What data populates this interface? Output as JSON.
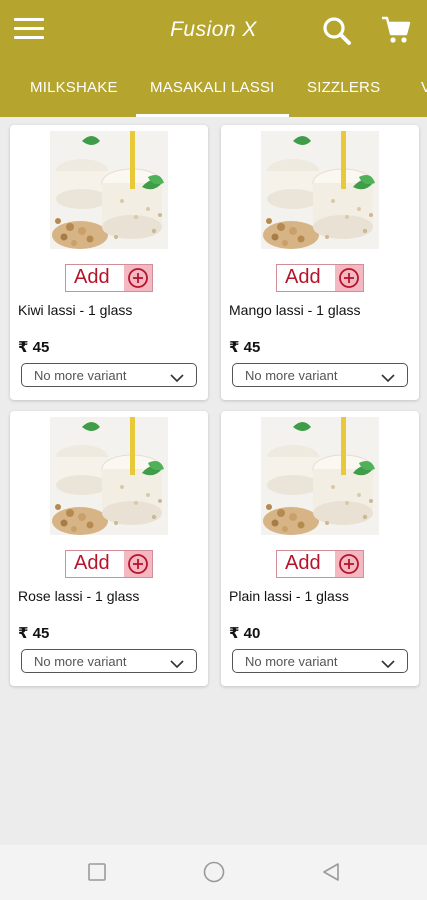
{
  "app": {
    "title": "Fusion X",
    "colors": {
      "primary": "#b5a52e",
      "accent": "#b5142a",
      "background": "#ececec"
    },
    "icons": {
      "menu": "hamburger-menu-icon",
      "search": "search-icon",
      "cart": "cart-icon"
    }
  },
  "tabs": [
    {
      "label": "MILKSHAKE",
      "active": false
    },
    {
      "label": "MASAKALI LASSI",
      "active": true
    },
    {
      "label": "SIZZLERS",
      "active": false
    },
    {
      "label": "V",
      "active": false
    }
  ],
  "products": [
    {
      "name": "Kiwi lassi - 1 glass",
      "price": "₹ 45",
      "add_label": "Add",
      "variant": "No more variant"
    },
    {
      "name": "Mango lassi - 1 glass",
      "price": "₹ 45",
      "add_label": "Add",
      "variant": "No more variant"
    },
    {
      "name": "Rose lassi - 1 glass",
      "price": "₹ 45",
      "add_label": "Add",
      "variant": "No more variant"
    },
    {
      "name": "Plain lassi - 1 glass",
      "price": "₹ 40",
      "add_label": "Add",
      "variant": "No more variant"
    }
  ],
  "navbar": {
    "icons": [
      "recent-apps-icon",
      "home-icon",
      "back-icon"
    ]
  }
}
